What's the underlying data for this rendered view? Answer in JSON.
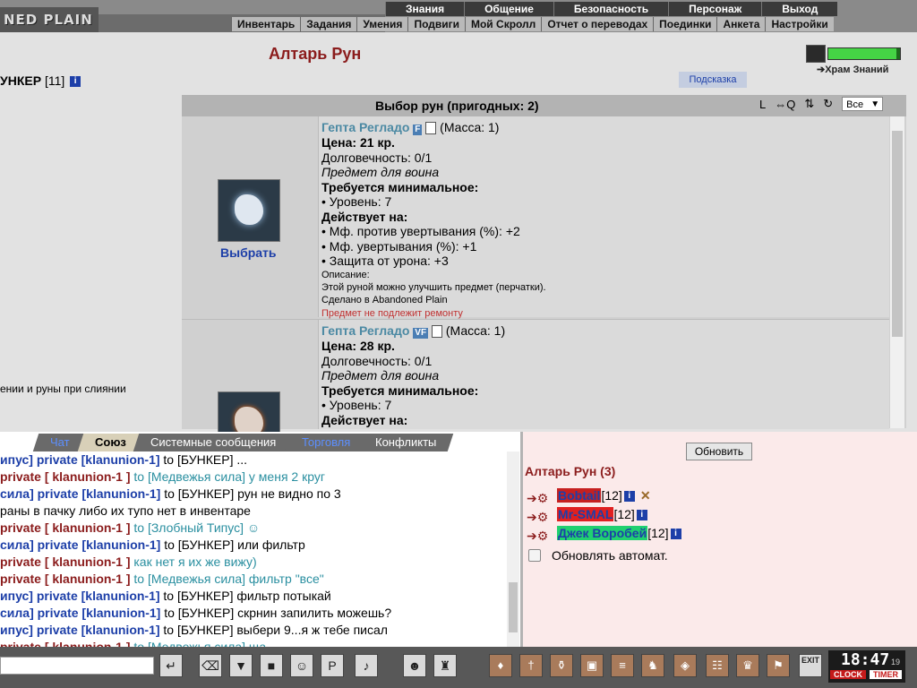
{
  "header": {
    "logo_text": "NED PLAIN",
    "nav_top": [
      "Знания",
      "Общение",
      "Безопасность",
      "Персонаж",
      "Выход"
    ],
    "nav_bottom": [
      "Инвентарь",
      "Задания",
      "Умения",
      "Подвиги",
      "Мой Скролл",
      "Отчет о переводах",
      "Поединки",
      "Анкета",
      "Настройки"
    ]
  },
  "page": {
    "title": "Алтарь Рун",
    "player_name": "УНКЕР",
    "player_level": "[11]",
    "left_note": "ении и руны при слиянии",
    "temple_link": "Храм Знаний",
    "hint_button": "Подсказка"
  },
  "rune_panel": {
    "title": "Выбор рун (пригодных: 2)",
    "tools": [
      "L",
      "⇔Q",
      "⇅",
      "↻"
    ],
    "filter_selected": "Все",
    "items": [
      {
        "name": "Гепта Регладо",
        "tag": "F",
        "mass": "(Масса: 1)",
        "price": "Цена: 21 кр.",
        "durability": "Долговечность: 0/1",
        "item_for": "Предмет для воина",
        "req_header": "Требуется минимальное:",
        "req_level": "• Уровень: 7",
        "acts_header": "Действует на:",
        "effects": [
          "• Мф. против увертывания (%): +2",
          "• Мф. увертывания (%): +1",
          "• Защита от урона: +3"
        ],
        "desc_header": "Описание:",
        "desc": "Этой руной можно улучшить предмет (перчатки).",
        "made_in": "Сделано в Abandoned Plain",
        "no_repair": "Предмет не подлежит ремонту",
        "choose": "Выбрать"
      },
      {
        "name": "Гепта Регладо",
        "tag": "VF",
        "mass": "(Масса: 1)",
        "price": "Цена: 28 кр.",
        "durability": "Долговечность: 0/1",
        "item_for": "Предмет для воина",
        "req_header": "Требуется минимальное:",
        "req_level": "• Уровень: 7",
        "acts_header": "Действует на:"
      }
    ]
  },
  "chat": {
    "tabs": [
      "Чат",
      "Союз",
      "Системные сообщения",
      "Торговля",
      "Конфликты"
    ],
    "active_tab": "Союз",
    "lines": [
      {
        "prefix": "ипус]",
        "nick": "private [klanunion-1]",
        "target": "to [БУНКЕР]",
        "text": "...",
        "nick_blue": true,
        "target_black": true
      },
      {
        "prefix": "private",
        "nick": "[ klanunion-1 ]",
        "target": "to [Медвежья сила]",
        "text": "у меня 2 круг",
        "nick_blue": false,
        "target_black": false
      },
      {
        "prefix": "сила]",
        "nick": "private [klanunion-1]",
        "target": "to [БУНКЕР]",
        "text": "рун не видно по 3",
        "nick_blue": true,
        "target_black": true
      },
      {
        "prefix": "",
        "nick": "",
        "target": "",
        "text": "раны в пачку либо их тупо нет в инвентаре",
        "nick_blue": false,
        "target_black": true
      },
      {
        "prefix": "private",
        "nick": "[ klanunion-1 ]",
        "target": "to [Злобный Типус]",
        "text": "☺",
        "nick_blue": false,
        "target_black": false
      },
      {
        "prefix": "сила]",
        "nick": "private [klanunion-1]",
        "target": "to [БУНКЕР]",
        "text": "или фильтр",
        "nick_blue": true,
        "target_black": true
      },
      {
        "prefix": "private",
        "nick": "[ klanunion-1 ]",
        "target": "",
        "text": "как нет я их же вижу)",
        "nick_blue": false,
        "target_black": false
      },
      {
        "prefix": "private",
        "nick": "[ klanunion-1 ]",
        "target": "to [Медвежья сила]",
        "text": "фильтр \"все\"",
        "nick_blue": false,
        "target_black": false
      },
      {
        "prefix": "ипус]",
        "nick": "private [klanunion-1]",
        "target": "to [БУНКЕР]",
        "text": "фильтр потыкай",
        "nick_blue": true,
        "target_black": true
      },
      {
        "prefix": "сила]",
        "nick": "private [klanunion-1]",
        "target": "to [БУНКЕР]",
        "text": "скрнин запилить можешь?",
        "nick_blue": true,
        "target_black": true
      },
      {
        "prefix": "ипус]",
        "nick": "private [klanunion-1]",
        "target": "to [БУНКЕР]",
        "text": "выбери 9...я ж тебе писал",
        "nick_blue": true,
        "target_black": true
      },
      {
        "prefix": "private",
        "nick": "[ klanunion-1 ]",
        "target": "to [Медвежья сила]",
        "text": "ща",
        "nick_blue": false,
        "target_black": false
      }
    ]
  },
  "room": {
    "refresh": "Обновить",
    "title": "Алтарь Рун (3)",
    "players": [
      {
        "name": "Bobtail",
        "level": "[12]",
        "bg": "#c52020",
        "fg": "#1d3fa8",
        "extra": "✕"
      },
      {
        "name": "Mr-SMAL",
        "level": "[12]",
        "bg": "#e02020",
        "fg": "#1d3fa8",
        "extra": ""
      },
      {
        "name": "Джек Воробей",
        "level": "[12]",
        "bg": "#20d070",
        "fg": "#1d3fa8",
        "extra": ""
      }
    ],
    "auto_refresh": "Обновлять автомат."
  },
  "energy": {
    "fill": 0.95
  },
  "clock": {
    "time": "18:47",
    "seconds": "19",
    "label_clock": "CLOCK",
    "label_timer": "TIMER"
  },
  "toolbar": {
    "exit_label": "EXIT"
  }
}
